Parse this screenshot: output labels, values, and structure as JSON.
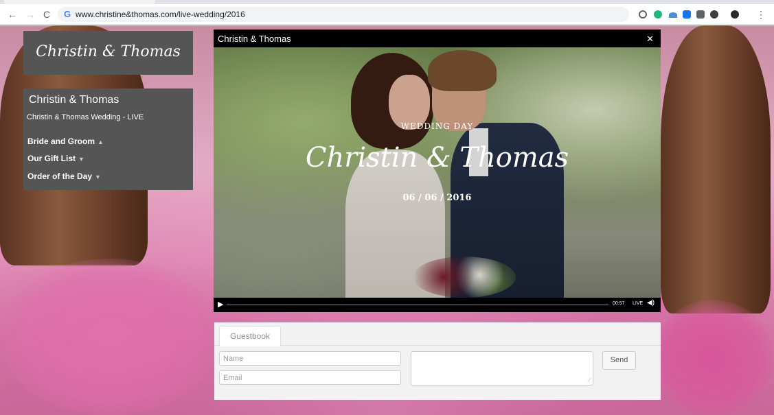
{
  "browser": {
    "url": "www.christine&thomas.com/live-wedding/2016",
    "back_glyph": "←",
    "forward_glyph": "→",
    "reload_glyph": "C",
    "site_icon_glyph": "G",
    "menu_glyph": "⋮"
  },
  "sidebar": {
    "logo_text": "Christin & Thomas",
    "title": "Christin & Thomas",
    "subtitle": "Christin & Thomas Wedding - LIVE",
    "menu": [
      {
        "label": "Bride and Groom",
        "caret": "▲"
      },
      {
        "label": "Our Gift List",
        "caret": "▼"
      },
      {
        "label": "Order of the Day",
        "caret": "▼"
      }
    ]
  },
  "video": {
    "title": "Christin  & Thomas",
    "fullscreen_glyph": "✕",
    "overlay_label": "WEDDING DAY",
    "overlay_names": "Christin & Thomas",
    "overlay_date": "06 / 06 / 2016",
    "play_glyph": "▶",
    "time": "00:57",
    "live_label": "LIVE",
    "volume_glyph": "◀)",
    "progress": 0.0
  },
  "guestbook": {
    "tab_label": "Guestbook",
    "name_placeholder": "Name",
    "email_placeholder": "Email",
    "message_value": "",
    "send_label": "Send",
    "resize_glyph": "⟋"
  },
  "colors": {
    "panel_bg": "#555555",
    "panel_text": "#ffffff",
    "guestbook_bg": "#f2f2f2",
    "video_bg": "#000000"
  }
}
